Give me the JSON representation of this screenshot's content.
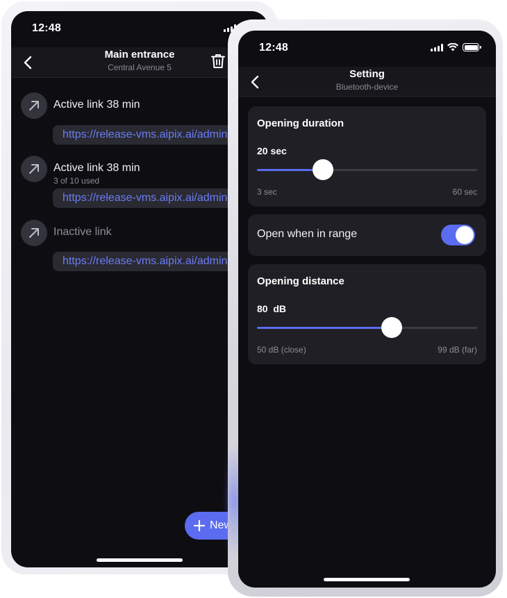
{
  "back_screen": {
    "status": {
      "time": "12:48"
    },
    "header": {
      "title": "Main entrance",
      "subtitle": "Central Avenue 5"
    },
    "links": [
      {
        "title": "Active link 38 min",
        "meta": "",
        "url": "https://release-vms.aipix.ai/admin",
        "active": true
      },
      {
        "title": "Active link 38 min",
        "meta": "3 of 10 used",
        "url": "https://release-vms.aipix.ai/admin",
        "active": true
      },
      {
        "title": "Inactive link",
        "meta": "",
        "url": "https://release-vms.aipix.ai/admin",
        "active": false
      }
    ],
    "fab_label": "New"
  },
  "front_screen": {
    "status": {
      "time": "12:48"
    },
    "header": {
      "title": "Setting",
      "subtitle": "Bluetooth-device"
    },
    "opening_duration": {
      "title": "Opening duration",
      "value_label": "20 sec",
      "min_label": "3 sec",
      "max_label": "60 sec",
      "value": 20,
      "min": 3,
      "max": 60
    },
    "open_in_range": {
      "label": "Open when in range",
      "enabled": true
    },
    "opening_distance": {
      "title": "Opening distance",
      "value_label": "80  dB",
      "min_label": "50 dB (close)",
      "max_label": "99 dB (far)",
      "value": 80,
      "min": 50,
      "max": 99
    }
  },
  "colors": {
    "accent": "#5b6cf0",
    "background": "#0e0e12",
    "card": "#1f1f25",
    "link": "#6b7cf6"
  }
}
